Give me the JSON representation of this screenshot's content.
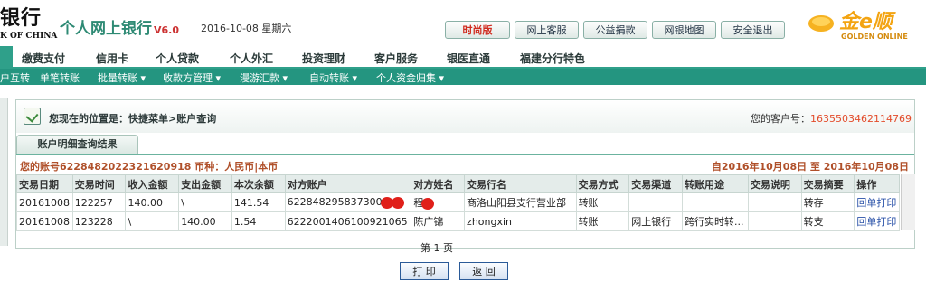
{
  "header": {
    "bank_name": "银行",
    "bank_sub": "K OF CHINA",
    "app_title": "个人网上银行",
    "app_version": "V6.0",
    "date": "2016-10-08 星期六",
    "buttons": [
      "时尚版",
      "网上客服",
      "公益捐款",
      "网银地图",
      "安全退出"
    ],
    "gold_name": "金e顺",
    "gold_en": "GOLDEN ONLINE"
  },
  "nav_main": [
    "缴费支付",
    "信用卡",
    "个人贷款",
    "个人外汇",
    "投资理财",
    "客户服务",
    "银医直通",
    "福建分行特色"
  ],
  "nav_sub": [
    "户互转",
    "单笔转账",
    "批量转账 ▾",
    "收款方管理 ▾",
    "漫游汇款 ▾",
    "自动转账 ▾",
    "个人资金归集 ▾"
  ],
  "location": {
    "text": "您现在的位置是：快捷菜单>账户查询",
    "cust_label": "您的客户号：",
    "cust_no": "1635503462114769"
  },
  "result_tab": "账户明细查询结果",
  "account": {
    "left": "您的账号6228482022321620918 币种：人民币|本币",
    "right": "自2016年10月08日  至  2016年10月08日"
  },
  "table": {
    "headers": [
      "交易日期",
      "交易时间",
      "收入金额",
      "支出金额",
      "本次余额",
      "对方账户",
      "对方姓名",
      "交易行名",
      "交易方式",
      "交易渠道",
      "转账用途",
      "交易说明",
      "交易摘要",
      "操作"
    ],
    "rows": [
      [
        "20161008",
        "122257",
        "140.00",
        "\\",
        "141.54",
        "622848295837300",
        "程",
        "商洛山阳县支行营业部",
        "转账",
        "",
        "",
        "",
        "转存",
        "回单打印"
      ],
      [
        "20161008",
        "123228",
        "\\",
        "140.00",
        "1.54",
        "6222001406100921065",
        "陈广锦",
        "zhongxin",
        "转账",
        "网上银行",
        "跨行实时转...",
        "",
        "转支",
        "回单打印"
      ]
    ]
  },
  "pager": "第 1 页",
  "actions": {
    "print": "打 印",
    "back": "返 回"
  },
  "colors": {
    "accent": "#2fa08a",
    "alert": "#e34b2a"
  }
}
